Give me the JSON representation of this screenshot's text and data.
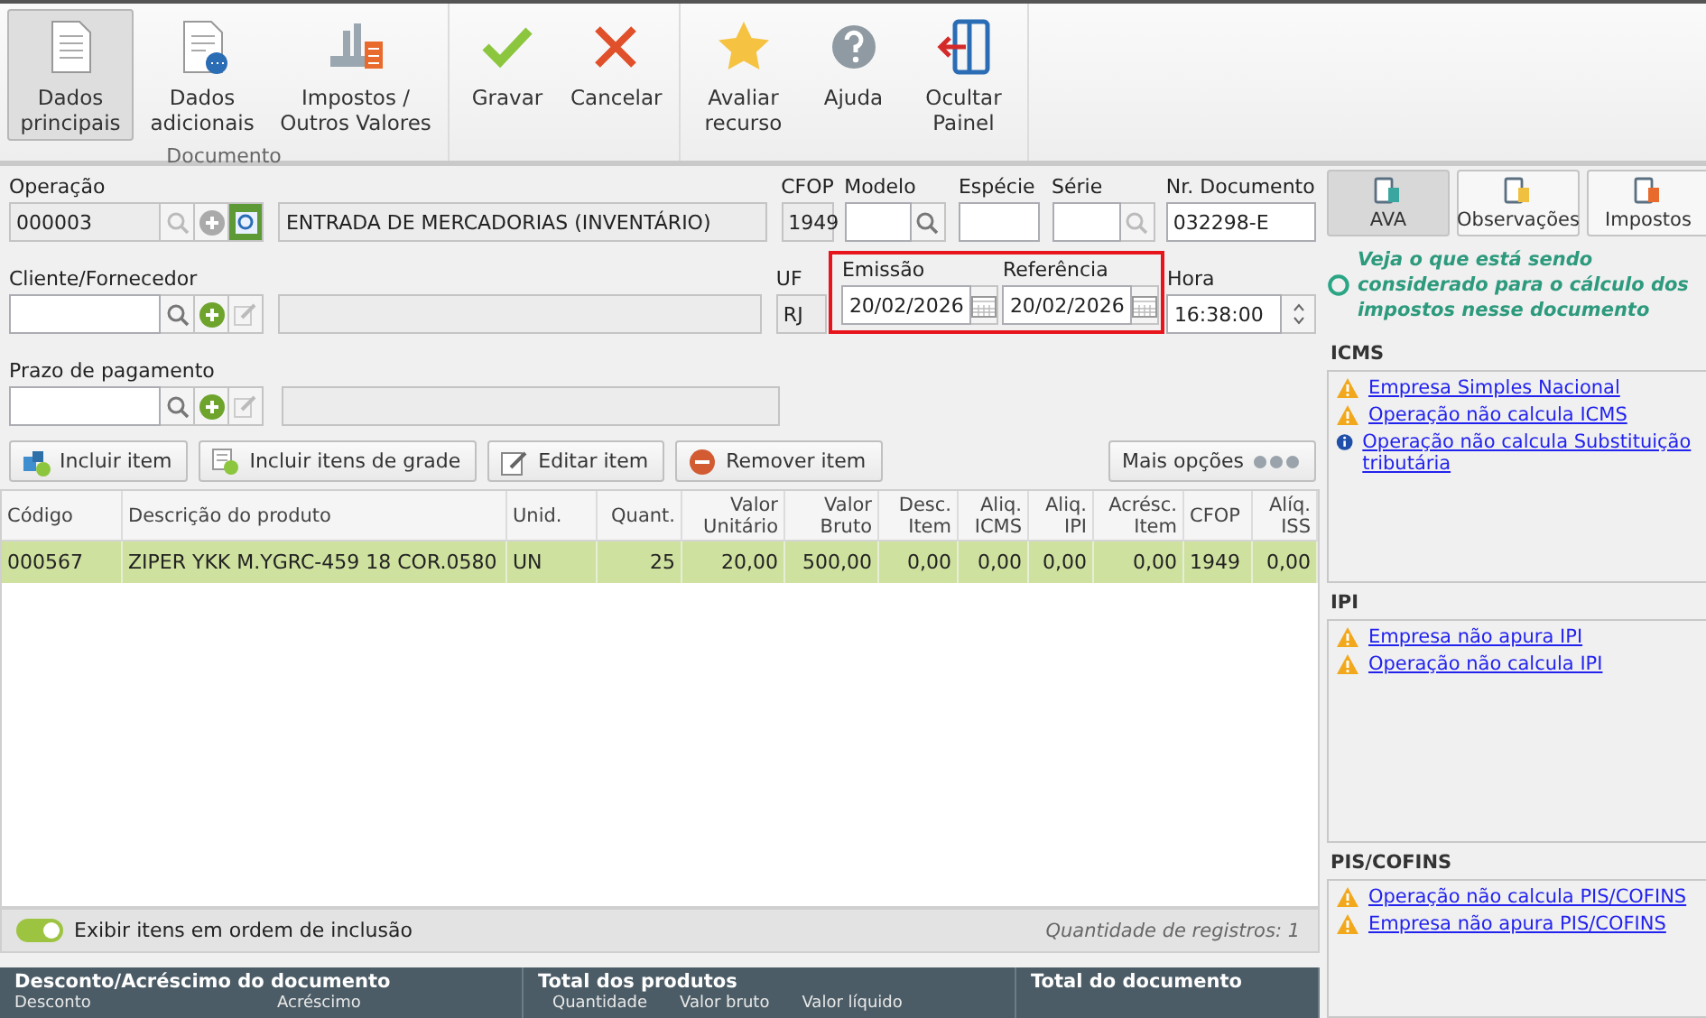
{
  "toolbar": {
    "groups": [
      {
        "label": "Documento",
        "buttons": [
          {
            "label": "Dados principais",
            "kind": "document",
            "selected": true
          },
          {
            "label": "Dados adicionais",
            "kind": "document-more",
            "selected": false
          },
          {
            "label": "Impostos / Outros Valores",
            "kind": "calculator",
            "selected": false
          }
        ]
      },
      {
        "buttons": [
          {
            "label": "Gravar",
            "kind": "check",
            "selected": false
          },
          {
            "label": "Cancelar",
            "kind": "cross",
            "selected": false
          }
        ]
      },
      {
        "buttons": [
          {
            "label": "Avaliar recurso",
            "kind": "star",
            "selected": false
          },
          {
            "label": "Ajuda",
            "kind": "help",
            "selected": false
          },
          {
            "label": "Ocultar Painel",
            "kind": "hide-panel",
            "selected": false
          }
        ]
      }
    ]
  },
  "form": {
    "operacao": {
      "label": "Operação",
      "code": "000003",
      "description": "ENTRADA DE MERCADORIAS (INVENTÁRIO)"
    },
    "cfop": {
      "label": "CFOP",
      "value": "1949"
    },
    "modelo": {
      "label": "Modelo"
    },
    "especie": {
      "label": "Espécie"
    },
    "serie": {
      "label": "Série"
    },
    "nr_documento": {
      "label": "Nr. Documento",
      "value": "032298-E"
    },
    "cliente": {
      "label": "Cliente/Fornecedor"
    },
    "uf": {
      "label": "UF",
      "value": "RJ"
    },
    "dates": {
      "highlighted": true,
      "fields": [
        {
          "label": "Emissão",
          "value": "20/02/2026"
        },
        {
          "label": "Referência",
          "value": "20/02/2026"
        }
      ]
    },
    "hora": {
      "label": "Hora",
      "value": "16:38:00"
    },
    "prazo": {
      "label": "Prazo de pagamento"
    }
  },
  "actions": [
    {
      "label": "Incluir item",
      "kind": "add-box"
    },
    {
      "label": "Incluir itens de grade",
      "kind": "add-grid"
    },
    {
      "label": "Editar item",
      "kind": "edit"
    },
    {
      "label": "Remover item",
      "kind": "remove"
    }
  ],
  "more_button": {
    "label": "Mais opções"
  },
  "table": {
    "columns": [
      {
        "label": "Código",
        "numeric": false
      },
      {
        "label": "Descrição do produto",
        "numeric": false
      },
      {
        "label": "Unid.",
        "numeric": false
      },
      {
        "label": "Quant.",
        "numeric": true
      },
      {
        "label": "Valor Unitário",
        "numeric": true
      },
      {
        "label": "Valor Bruto",
        "numeric": true
      },
      {
        "label": "Desc. Item",
        "numeric": true
      },
      {
        "label": "Aliq. ICMS",
        "numeric": true
      },
      {
        "label": "Aliq. IPI",
        "numeric": true
      },
      {
        "label": "Acrésc. Item",
        "numeric": true
      },
      {
        "label": "CFOP",
        "numeric": false
      },
      {
        "label": "Alíq. ISS",
        "numeric": true
      }
    ],
    "rows": [
      {
        "selected": true,
        "cells": [
          "000567",
          "ZIPER YKK M.YGRC-459 18 COR.0580",
          "UN",
          "25",
          "20,00",
          "500,00",
          "0,00",
          "0,00",
          "0,00",
          "0,00",
          "1949",
          "0,00"
        ]
      }
    ]
  },
  "footer": {
    "toggle": {
      "label": "Exibir itens em ordem de inclusão",
      "on": true
    },
    "count": "Quantidade de registros: 1"
  },
  "summary": [
    {
      "title": "Desconto/Acréscimo do documento",
      "fields": [
        "Desconto",
        "Acréscimo"
      ]
    },
    {
      "title": "Total dos produtos",
      "fields": [
        "Quantidade",
        "Valor bruto",
        "Valor líquido"
      ]
    },
    {
      "title": "Total do documento"
    }
  ],
  "panel": {
    "tabs": [
      {
        "label": "AVA",
        "selected": true
      },
      {
        "label": "Observações",
        "selected": false
      },
      {
        "label": "Impostos",
        "selected": false
      }
    ],
    "info": "Veja o que está sendo considerado para o cálculo dos impostos nesse documento",
    "sections": [
      {
        "title": "ICMS",
        "items": [
          {
            "kind": "warning",
            "text": "Empresa Simples Nacional"
          },
          {
            "kind": "warning",
            "text": "Operação não calcula ICMS"
          },
          {
            "kind": "info",
            "text": "Operação não calcula Substituição tributária"
          }
        ]
      },
      {
        "title": "IPI",
        "items": [
          {
            "kind": "warning",
            "text": "Empresa não apura IPI"
          },
          {
            "kind": "warning",
            "text": "Operação não calcula IPI"
          }
        ]
      },
      {
        "title": "PIS/COFINS",
        "items": [
          {
            "kind": "warning",
            "text": "Operação não calcula PIS/COFINS"
          },
          {
            "kind": "warning",
            "text": "Empresa não apura PIS/COFINS"
          }
        ]
      }
    ]
  }
}
